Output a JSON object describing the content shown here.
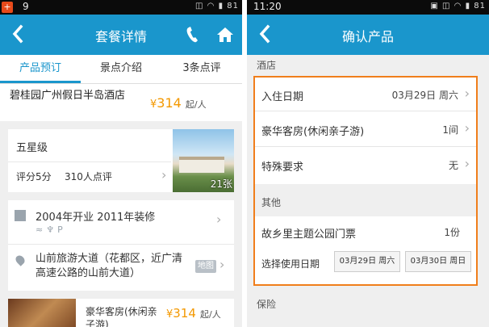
{
  "left": {
    "status_time": "9",
    "status_right": "81",
    "nav_title": "套餐详情",
    "tabs": [
      "产品预订",
      "景点介绍",
      "3条点评"
    ],
    "hotel": {
      "name": "碧桂园广州假日半岛酒店",
      "price_symbol": "¥",
      "price": "314",
      "price_unit": "起/人"
    },
    "rating": {
      "stars": "五星级",
      "score": "评分5分",
      "reviews": "310人点评",
      "photo_count": "21张"
    },
    "info": {
      "year": "2004年开业 2011年装修",
      "address": "山前旅游大道（花都区，近广清高速公路的山前大道）",
      "map_label": "地图"
    },
    "room": {
      "name": "豪华客房(休闲亲子游)",
      "price_symbol": "¥",
      "price": "314",
      "price_unit": "起/人"
    },
    "colors": {
      "accent": "#1a96cc",
      "price": "#f39800"
    }
  },
  "right": {
    "status_time": "11:20",
    "status_right": "81",
    "nav_title": "确认产品",
    "section_hotel": "酒店",
    "checkin_label": "入住日期",
    "checkin_value": "03月29日 周六",
    "room_label": "豪华客房(休闲亲子游)",
    "room_value": "1间",
    "special_label": "特殊要求",
    "special_value": "无",
    "section_other": "其他",
    "ticket_label": "故乡里主题公园门票",
    "ticket_value": "1份",
    "date_select_label": "选择使用日期",
    "date_options": [
      "03月29日 周六",
      "03月30日 周日"
    ],
    "section_insurance": "保险",
    "colors": {
      "highlight_border": "#f07e1b"
    }
  }
}
